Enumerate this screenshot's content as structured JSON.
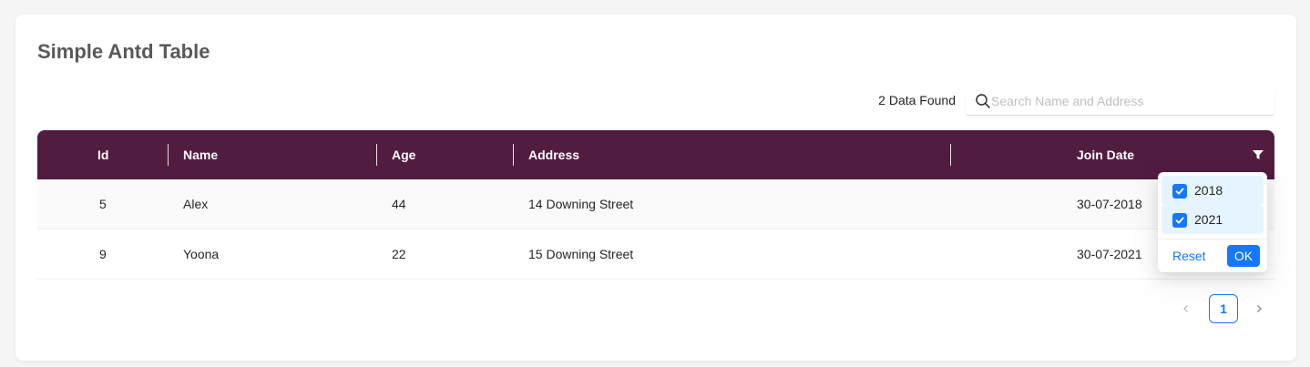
{
  "page": {
    "title": "Simple Antd Table",
    "data_count": "2 Data Found"
  },
  "search": {
    "placeholder": "Search Name and Address",
    "value": ""
  },
  "table": {
    "columns": [
      "Id",
      "Name",
      "Age",
      "Address",
      "Join Date"
    ],
    "rows": [
      {
        "id": "5",
        "name": "Alex",
        "age": "44",
        "address": "14 Downing Street",
        "join_date": "30-07-2018"
      },
      {
        "id": "9",
        "name": "Yoona",
        "age": "22",
        "address": "15 Downing Street",
        "join_date": "30-07-2021"
      }
    ],
    "header_color": "#521c41"
  },
  "filter": {
    "options": [
      {
        "label": "2018",
        "checked": true
      },
      {
        "label": "2021",
        "checked": true
      }
    ],
    "reset_label": "Reset",
    "ok_label": "OK"
  },
  "pagination": {
    "prev_icon": "chevron-left-icon",
    "current": "1",
    "next_icon": "chevron-right-icon"
  },
  "colors": {
    "accent": "#1677ff",
    "header_bg": "#521c41"
  }
}
